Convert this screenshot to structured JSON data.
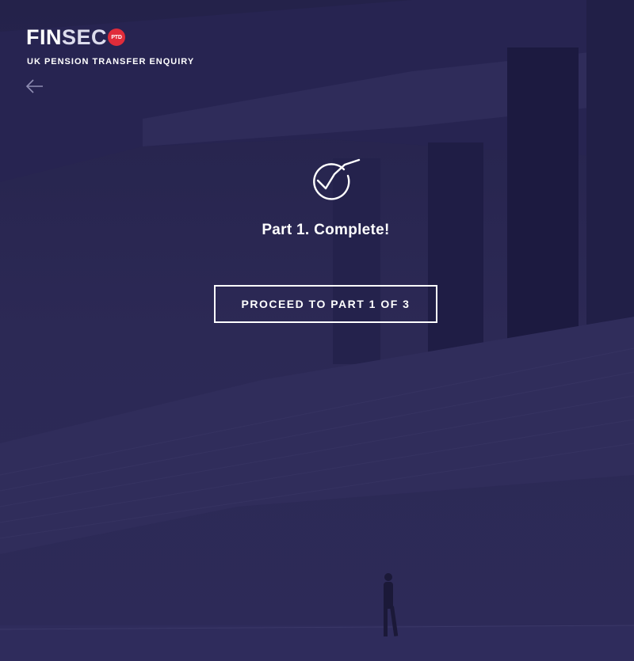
{
  "header": {
    "logo_main": "FIN",
    "logo_accent": "SEC",
    "logo_badge": "PTD",
    "subtitle": "UK PENSION TRANSFER ENQUIRY"
  },
  "icons": {
    "back": "arrow-left-icon",
    "success": "check-circle-icon"
  },
  "main": {
    "title": "Part 1. Complete!",
    "proceed_label": "PROCEED TO PART 1 OF 3"
  },
  "colors": {
    "background": "#2a2750",
    "badge": "#e02c3a",
    "text": "#ffffff"
  }
}
